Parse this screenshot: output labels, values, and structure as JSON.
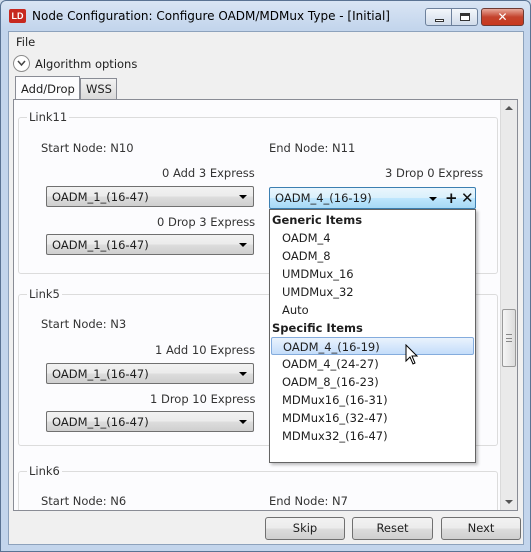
{
  "window": {
    "icon_text": "LD",
    "title": "Node Configuration: Configure OADM/MDMux Type - [Initial]",
    "minimize_glyph": "",
    "maximize_glyph": "",
    "close_glyph": "✕"
  },
  "menu": {
    "file": "File"
  },
  "algorithm_options": {
    "label": "Algorithm options"
  },
  "tabs": [
    {
      "label": "Add/Drop",
      "active": true
    },
    {
      "label": "WSS",
      "active": false
    }
  ],
  "links": [
    {
      "name": "Link11",
      "start_node": "Start Node: N10",
      "end_node": "End Node: N11",
      "start_count1": "0 Add 3 Express",
      "start_value1": "OADM_1_(16-47)",
      "start_count2": "0 Drop 3 Express",
      "start_value2": "OADM_1_(16-47)",
      "end_count1": "3 Drop 0 Express",
      "end_value1": "OADM_4_(16-19)"
    },
    {
      "name": "Link5",
      "start_node": "Start Node: N3",
      "start_count1": "1 Add 10 Express",
      "start_value1": "OADM_1_(16-47)",
      "start_count2": "1 Drop 10 Express",
      "start_value2": "OADM_1_(16-47)"
    },
    {
      "name": "Link6",
      "start_node": "Start Node: N6",
      "end_node": "End Node: N7"
    }
  ],
  "active_combo": {
    "plus_glyph": "+",
    "remove_glyph": "✕"
  },
  "dropdown": {
    "generic_header": "Generic Items",
    "generic_items": [
      "OADM_4",
      "OADM_8",
      "UMDMux_16",
      "UMDMux_32",
      "Auto"
    ],
    "specific_header": "Specific Items",
    "specific_items": [
      "OADM_4_(16-19)",
      "OADM_4_(24-27)",
      "OADM_8_(16-23)",
      "MDMux16_(16-31)",
      "MDMux16_(32-47)",
      "MDMux32_(16-47)"
    ],
    "selected": "OADM_4_(16-19)"
  },
  "buttons": {
    "skip": "Skip",
    "reset": "Reset",
    "next": "Next"
  }
}
